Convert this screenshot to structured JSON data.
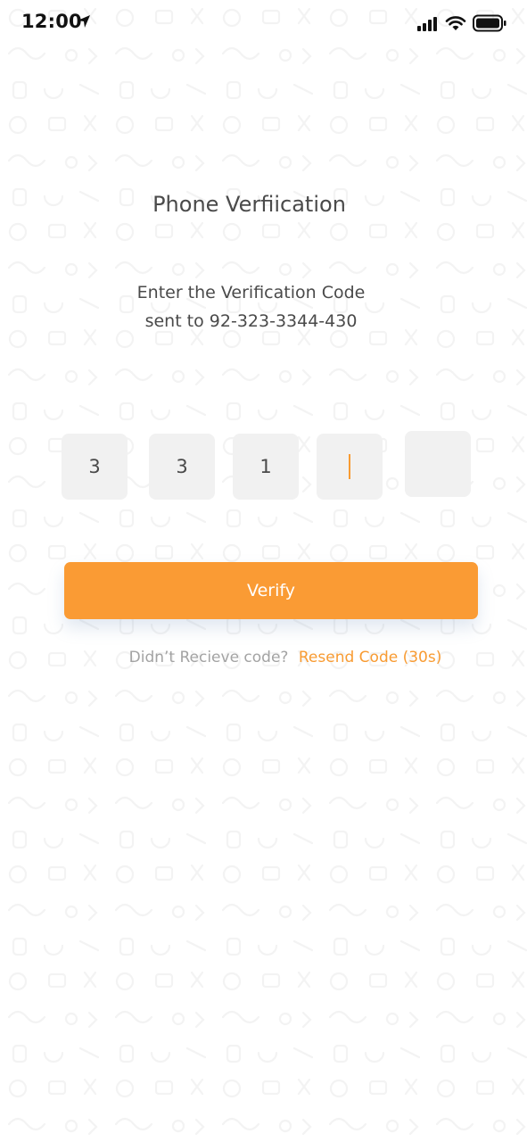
{
  "status_bar": {
    "time": "12:00",
    "icons": [
      "location-arrow-icon",
      "cellular-signal-icon",
      "wifi-icon",
      "battery-icon"
    ]
  },
  "screen": {
    "title": "Phone Verfiication",
    "instruction_line1": "Enter the Verification Code",
    "instruction_line2": "sent to 92-323-3344-430"
  },
  "code_inputs": [
    {
      "value": "3"
    },
    {
      "value": "3"
    },
    {
      "value": "1"
    },
    {
      "value": "",
      "focused": true
    },
    {
      "value": ""
    }
  ],
  "verify_button": {
    "label": "Verify"
  },
  "resend": {
    "prompt": "Didn’t Recieve code?",
    "link_label": "Resend Code (30s)"
  },
  "colors": {
    "accent": "#fa9b34",
    "input_bg": "#f1f1f1",
    "text": "#4a4a4a",
    "muted_text": "#a3a3a3",
    "background": "#ffffff"
  }
}
